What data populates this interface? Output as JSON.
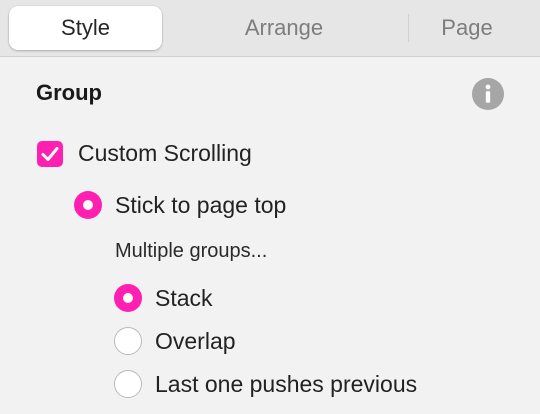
{
  "tabs": {
    "style": "Style",
    "arrange": "Arrange",
    "page": "Page"
  },
  "group": {
    "title": "Group",
    "info_icon": "info-icon",
    "custom_scrolling": {
      "label": "Custom Scrolling",
      "checked": true
    },
    "stick_to_page_top": {
      "label": "Stick to page top",
      "selected": true
    },
    "multiple_groups_label": "Multiple groups...",
    "multiple_groups_options": [
      {
        "label": "Stack",
        "selected": true
      },
      {
        "label": "Overlap",
        "selected": false
      },
      {
        "label": "Last one pushes previous",
        "selected": false
      }
    ]
  },
  "colors": {
    "accent": "#ff1fb0",
    "background": "#f2f2f2",
    "tabbar": "#e6e6e6"
  }
}
